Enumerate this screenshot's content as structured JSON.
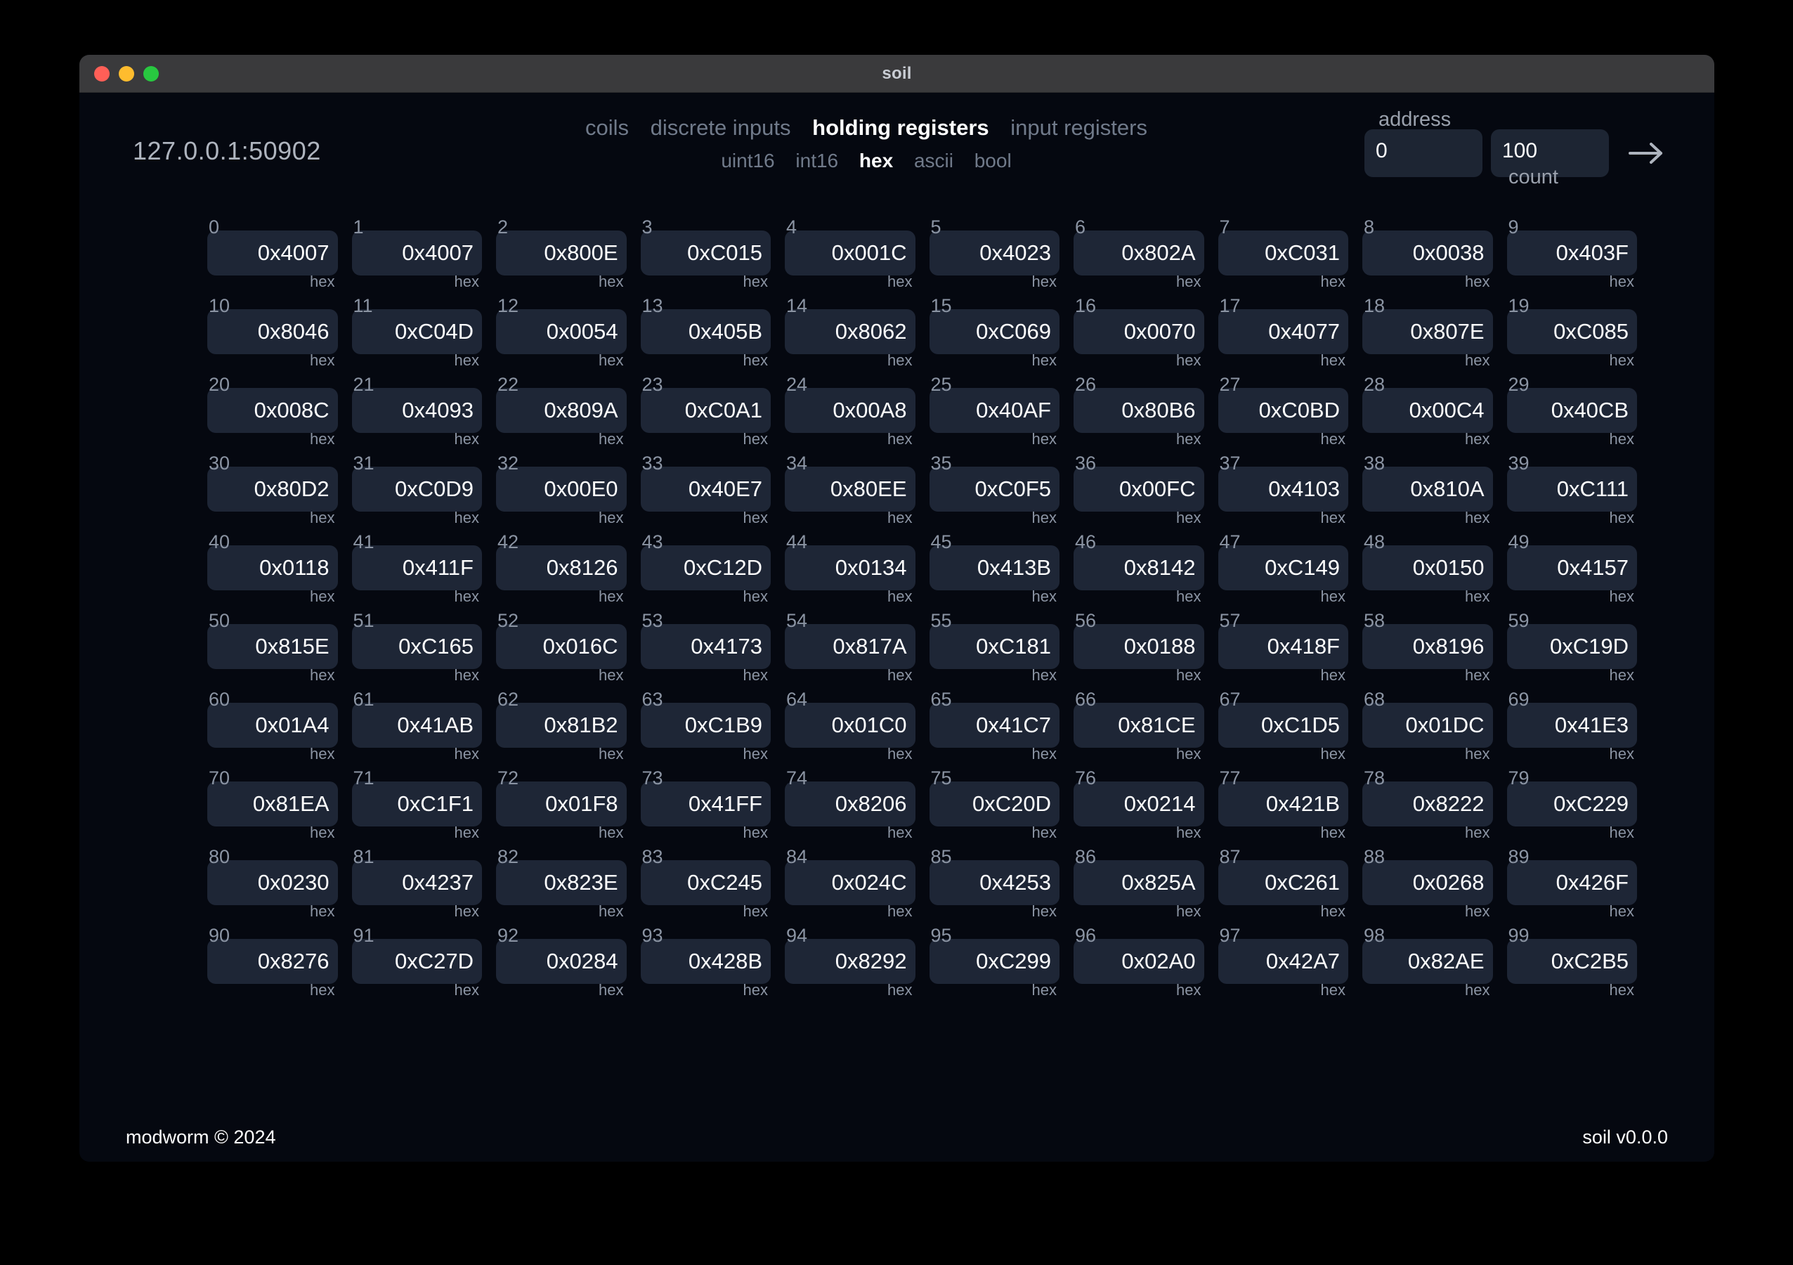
{
  "window": {
    "title": "soil",
    "traffic_lights": [
      {
        "name": "close",
        "color": "#ff5f57"
      },
      {
        "name": "minimize",
        "color": "#febc2e"
      },
      {
        "name": "maximize",
        "color": "#28c840"
      }
    ]
  },
  "header": {
    "connection_address": "127.0.0.1:50902",
    "table_tabs": [
      {
        "label": "coils",
        "active": false
      },
      {
        "label": "discrete inputs",
        "active": false
      },
      {
        "label": "holding registers",
        "active": true
      },
      {
        "label": "input registers",
        "active": false
      }
    ],
    "format_tabs": [
      {
        "label": "uint16",
        "active": false
      },
      {
        "label": "int16",
        "active": false
      },
      {
        "label": "hex",
        "active": true
      },
      {
        "label": "ascii",
        "active": false
      },
      {
        "label": "bool",
        "active": false
      }
    ],
    "address_label": "address",
    "address_value": "0",
    "count_label": "count",
    "count_value": "100",
    "submit_icon": "arrow-right-icon"
  },
  "registers": {
    "format": "hex",
    "items": [
      {
        "index": "0",
        "value": "0x4007",
        "type": "hex"
      },
      {
        "index": "1",
        "value": "0x4007",
        "type": "hex"
      },
      {
        "index": "2",
        "value": "0x800E",
        "type": "hex"
      },
      {
        "index": "3",
        "value": "0xC015",
        "type": "hex"
      },
      {
        "index": "4",
        "value": "0x001C",
        "type": "hex"
      },
      {
        "index": "5",
        "value": "0x4023",
        "type": "hex"
      },
      {
        "index": "6",
        "value": "0x802A",
        "type": "hex"
      },
      {
        "index": "7",
        "value": "0xC031",
        "type": "hex"
      },
      {
        "index": "8",
        "value": "0x0038",
        "type": "hex"
      },
      {
        "index": "9",
        "value": "0x403F",
        "type": "hex"
      },
      {
        "index": "10",
        "value": "0x8046",
        "type": "hex"
      },
      {
        "index": "11",
        "value": "0xC04D",
        "type": "hex"
      },
      {
        "index": "12",
        "value": "0x0054",
        "type": "hex"
      },
      {
        "index": "13",
        "value": "0x405B",
        "type": "hex"
      },
      {
        "index": "14",
        "value": "0x8062",
        "type": "hex"
      },
      {
        "index": "15",
        "value": "0xC069",
        "type": "hex"
      },
      {
        "index": "16",
        "value": "0x0070",
        "type": "hex"
      },
      {
        "index": "17",
        "value": "0x4077",
        "type": "hex"
      },
      {
        "index": "18",
        "value": "0x807E",
        "type": "hex"
      },
      {
        "index": "19",
        "value": "0xC085",
        "type": "hex"
      },
      {
        "index": "20",
        "value": "0x008C",
        "type": "hex"
      },
      {
        "index": "21",
        "value": "0x4093",
        "type": "hex"
      },
      {
        "index": "22",
        "value": "0x809A",
        "type": "hex"
      },
      {
        "index": "23",
        "value": "0xC0A1",
        "type": "hex"
      },
      {
        "index": "24",
        "value": "0x00A8",
        "type": "hex"
      },
      {
        "index": "25",
        "value": "0x40AF",
        "type": "hex"
      },
      {
        "index": "26",
        "value": "0x80B6",
        "type": "hex"
      },
      {
        "index": "27",
        "value": "0xC0BD",
        "type": "hex"
      },
      {
        "index": "28",
        "value": "0x00C4",
        "type": "hex"
      },
      {
        "index": "29",
        "value": "0x40CB",
        "type": "hex"
      },
      {
        "index": "30",
        "value": "0x80D2",
        "type": "hex"
      },
      {
        "index": "31",
        "value": "0xC0D9",
        "type": "hex"
      },
      {
        "index": "32",
        "value": "0x00E0",
        "type": "hex"
      },
      {
        "index": "33",
        "value": "0x40E7",
        "type": "hex"
      },
      {
        "index": "34",
        "value": "0x80EE",
        "type": "hex"
      },
      {
        "index": "35",
        "value": "0xC0F5",
        "type": "hex"
      },
      {
        "index": "36",
        "value": "0x00FC",
        "type": "hex"
      },
      {
        "index": "37",
        "value": "0x4103",
        "type": "hex"
      },
      {
        "index": "38",
        "value": "0x810A",
        "type": "hex"
      },
      {
        "index": "39",
        "value": "0xC111",
        "type": "hex"
      },
      {
        "index": "40",
        "value": "0x0118",
        "type": "hex"
      },
      {
        "index": "41",
        "value": "0x411F",
        "type": "hex"
      },
      {
        "index": "42",
        "value": "0x8126",
        "type": "hex"
      },
      {
        "index": "43",
        "value": "0xC12D",
        "type": "hex"
      },
      {
        "index": "44",
        "value": "0x0134",
        "type": "hex"
      },
      {
        "index": "45",
        "value": "0x413B",
        "type": "hex"
      },
      {
        "index": "46",
        "value": "0x8142",
        "type": "hex"
      },
      {
        "index": "47",
        "value": "0xC149",
        "type": "hex"
      },
      {
        "index": "48",
        "value": "0x0150",
        "type": "hex"
      },
      {
        "index": "49",
        "value": "0x4157",
        "type": "hex"
      },
      {
        "index": "50",
        "value": "0x815E",
        "type": "hex"
      },
      {
        "index": "51",
        "value": "0xC165",
        "type": "hex"
      },
      {
        "index": "52",
        "value": "0x016C",
        "type": "hex"
      },
      {
        "index": "53",
        "value": "0x4173",
        "type": "hex"
      },
      {
        "index": "54",
        "value": "0x817A",
        "type": "hex"
      },
      {
        "index": "55",
        "value": "0xC181",
        "type": "hex"
      },
      {
        "index": "56",
        "value": "0x0188",
        "type": "hex"
      },
      {
        "index": "57",
        "value": "0x418F",
        "type": "hex"
      },
      {
        "index": "58",
        "value": "0x8196",
        "type": "hex"
      },
      {
        "index": "59",
        "value": "0xC19D",
        "type": "hex"
      },
      {
        "index": "60",
        "value": "0x01A4",
        "type": "hex"
      },
      {
        "index": "61",
        "value": "0x41AB",
        "type": "hex"
      },
      {
        "index": "62",
        "value": "0x81B2",
        "type": "hex"
      },
      {
        "index": "63",
        "value": "0xC1B9",
        "type": "hex"
      },
      {
        "index": "64",
        "value": "0x01C0",
        "type": "hex"
      },
      {
        "index": "65",
        "value": "0x41C7",
        "type": "hex"
      },
      {
        "index": "66",
        "value": "0x81CE",
        "type": "hex"
      },
      {
        "index": "67",
        "value": "0xC1D5",
        "type": "hex"
      },
      {
        "index": "68",
        "value": "0x01DC",
        "type": "hex"
      },
      {
        "index": "69",
        "value": "0x41E3",
        "type": "hex"
      },
      {
        "index": "70",
        "value": "0x81EA",
        "type": "hex"
      },
      {
        "index": "71",
        "value": "0xC1F1",
        "type": "hex"
      },
      {
        "index": "72",
        "value": "0x01F8",
        "type": "hex"
      },
      {
        "index": "73",
        "value": "0x41FF",
        "type": "hex"
      },
      {
        "index": "74",
        "value": "0x8206",
        "type": "hex"
      },
      {
        "index": "75",
        "value": "0xC20D",
        "type": "hex"
      },
      {
        "index": "76",
        "value": "0x0214",
        "type": "hex"
      },
      {
        "index": "77",
        "value": "0x421B",
        "type": "hex"
      },
      {
        "index": "78",
        "value": "0x8222",
        "type": "hex"
      },
      {
        "index": "79",
        "value": "0xC229",
        "type": "hex"
      },
      {
        "index": "80",
        "value": "0x0230",
        "type": "hex"
      },
      {
        "index": "81",
        "value": "0x4237",
        "type": "hex"
      },
      {
        "index": "82",
        "value": "0x823E",
        "type": "hex"
      },
      {
        "index": "83",
        "value": "0xC245",
        "type": "hex"
      },
      {
        "index": "84",
        "value": "0x024C",
        "type": "hex"
      },
      {
        "index": "85",
        "value": "0x4253",
        "type": "hex"
      },
      {
        "index": "86",
        "value": "0x825A",
        "type": "hex"
      },
      {
        "index": "87",
        "value": "0xC261",
        "type": "hex"
      },
      {
        "index": "88",
        "value": "0x0268",
        "type": "hex"
      },
      {
        "index": "89",
        "value": "0x426F",
        "type": "hex"
      },
      {
        "index": "90",
        "value": "0x8276",
        "type": "hex"
      },
      {
        "index": "91",
        "value": "0xC27D",
        "type": "hex"
      },
      {
        "index": "92",
        "value": "0x0284",
        "type": "hex"
      },
      {
        "index": "93",
        "value": "0x428B",
        "type": "hex"
      },
      {
        "index": "94",
        "value": "0x8292",
        "type": "hex"
      },
      {
        "index": "95",
        "value": "0xC299",
        "type": "hex"
      },
      {
        "index": "96",
        "value": "0x02A0",
        "type": "hex"
      },
      {
        "index": "97",
        "value": "0x42A7",
        "type": "hex"
      },
      {
        "index": "98",
        "value": "0x82AE",
        "type": "hex"
      },
      {
        "index": "99",
        "value": "0xC2B5",
        "type": "hex"
      }
    ]
  },
  "footer": {
    "left": "modworm © 2024",
    "right": "soil v0.0.0"
  },
  "colors": {
    "window_background": "#050810",
    "titlebar": "#3a3a3c",
    "card": "#1e2636",
    "field": "#1d2533",
    "muted_text": "#8b94a3",
    "active_text": "#ffffff"
  }
}
